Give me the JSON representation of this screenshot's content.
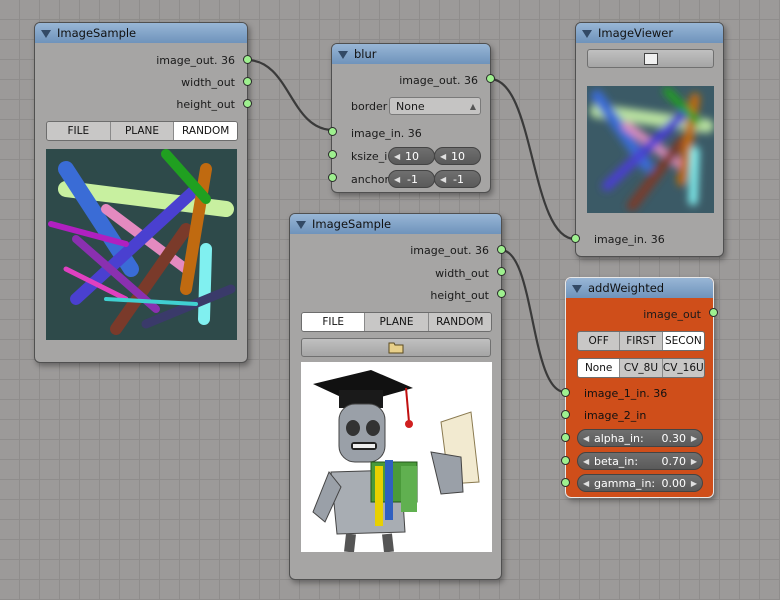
{
  "nodes": {
    "sample1": {
      "title": "ImageSample",
      "outputs": [
        "image_out. 36",
        "width_out",
        "height_out"
      ],
      "modes": [
        "FILE",
        "PLANE",
        "RANDOM"
      ],
      "active_mode": "RANDOM"
    },
    "blur": {
      "title": "blur",
      "output": "image_out. 36",
      "border_label": "border",
      "border_value": "None",
      "input_image": "image_in. 36",
      "ksize_label": "ksize_i",
      "ksize": [
        "10",
        "10"
      ],
      "anchor_label": "anchor",
      "anchor": [
        "-1",
        "-1"
      ]
    },
    "viewer": {
      "title": "ImageViewer",
      "input": "image_in. 36"
    },
    "sample2": {
      "title": "ImageSample",
      "outputs": [
        "image_out. 36",
        "width_out",
        "height_out"
      ],
      "modes": [
        "FILE",
        "PLANE",
        "RANDOM"
      ],
      "active_mode": "FILE"
    },
    "weighted": {
      "title": "addWeighted",
      "output": "image_out",
      "mode_row1": [
        "OFF",
        "FIRST",
        "SECON"
      ],
      "active_row1": "SECON",
      "mode_row2": [
        "None",
        "CV_8U",
        "CV_16U"
      ],
      "active_row2": "None",
      "inputs": [
        "image_1_in. 36",
        "image_2_in"
      ],
      "alpha_label": "alpha_in:",
      "alpha": "0.30",
      "beta_label": "beta_in:",
      "beta": "0.70",
      "gamma_label": "gamma_in:",
      "gamma": "0.00"
    }
  },
  "colors": {
    "header": "#7fa0c6",
    "socket": "#9ef08f",
    "orange_node": "#cf4e1a",
    "canvas": "#9c9a99"
  },
  "icons": [
    "collapse-triangle-icon",
    "folder-icon",
    "screen-icon"
  ]
}
